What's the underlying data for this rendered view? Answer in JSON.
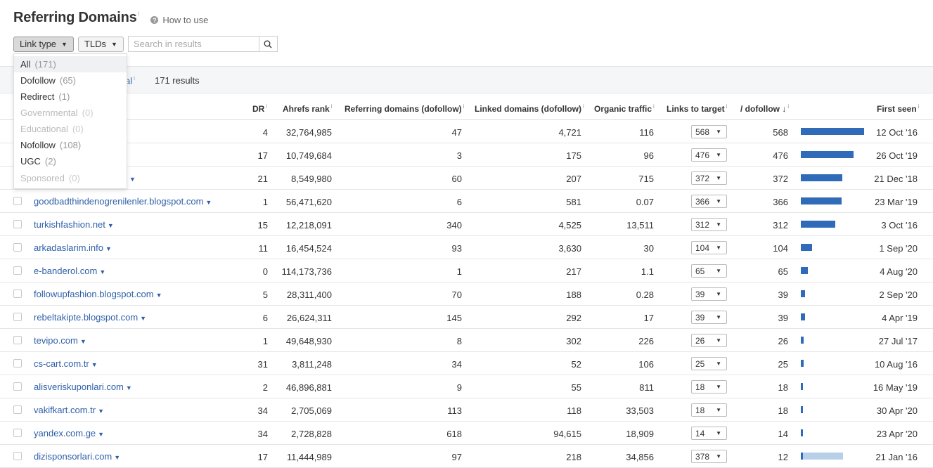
{
  "header": {
    "title": "Referring Domains",
    "info_glyph": "i",
    "how_to_label": "How to use"
  },
  "filters": {
    "link_type_label": "Link type",
    "tlds_label": "TLDs",
    "search_placeholder": "Search in results"
  },
  "link_type_menu": [
    {
      "label": "All",
      "count": "(171)",
      "enabled": true,
      "selected": true
    },
    {
      "label": "Dofollow",
      "count": "(65)",
      "enabled": true,
      "selected": false
    },
    {
      "label": "Redirect",
      "count": "(1)",
      "enabled": true,
      "selected": false
    },
    {
      "label": "Governmental",
      "count": "(0)",
      "enabled": false,
      "selected": false
    },
    {
      "label": "Educational",
      "count": "(0)",
      "enabled": false,
      "selected": false
    },
    {
      "label": "Nofollow",
      "count": "(108)",
      "enabled": true,
      "selected": false
    },
    {
      "label": "UGC",
      "count": "(2)",
      "enabled": true,
      "selected": false
    },
    {
      "label": "Sponsored",
      "count": "(0)",
      "enabled": false,
      "selected": false
    }
  ],
  "tabs": {
    "partial_tab_label": "al",
    "results": "171 results"
  },
  "table": {
    "headers": {
      "dr": "DR",
      "ahrefs_rank": "Ahrefs rank",
      "referring_domains": "Referring domains (dofollow)",
      "linked_domains": "Linked domains (dofollow)",
      "organic_traffic": "Organic traffic",
      "links_to_target": "Links to target",
      "dofollow": "/ dofollow",
      "sort_arrow": "↓",
      "first_seen": "First seen"
    },
    "max_links": 568,
    "rows": [
      {
        "domain": "",
        "dr": "4",
        "rank": "32,764,985",
        "ref": "47",
        "linked": "4,721",
        "traffic": "116",
        "links": "568",
        "dofollow": "568",
        "first_seen": "12 Oct '16",
        "dofollow_ratio": 1.0
      },
      {
        "domain": "",
        "dr": "17",
        "rank": "10,749,684",
        "ref": "3",
        "linked": "175",
        "traffic": "96",
        "links": "476",
        "dofollow": "476",
        "first_seen": "26 Oct '19",
        "dofollow_ratio": 1.0
      },
      {
        "domain": "",
        "dr": "21",
        "rank": "8,549,980",
        "ref": "60",
        "linked": "207",
        "traffic": "715",
        "links": "372",
        "dofollow": "372",
        "first_seen": "21 Dec '18",
        "dofollow_ratio": 1.0,
        "caret_only": true
      },
      {
        "domain": "goodbadthindenogrenilenler.blogspot.com",
        "dr": "1",
        "rank": "56,471,620",
        "ref": "6",
        "linked": "581",
        "traffic": "0.07",
        "links": "366",
        "dofollow": "366",
        "first_seen": "23 Mar '19",
        "dofollow_ratio": 1.0
      },
      {
        "domain": "turkishfashion.net",
        "dr": "15",
        "rank": "12,218,091",
        "ref": "340",
        "linked": "4,525",
        "traffic": "13,511",
        "links": "312",
        "dofollow": "312",
        "first_seen": "3 Oct '16",
        "dofollow_ratio": 1.0
      },
      {
        "domain": "arkadaslarim.info",
        "dr": "11",
        "rank": "16,454,524",
        "ref": "93",
        "linked": "3,630",
        "traffic": "30",
        "links": "104",
        "dofollow": "104",
        "first_seen": "1 Sep '20",
        "dofollow_ratio": 1.0
      },
      {
        "domain": "e-banderol.com",
        "dr": "0",
        "rank": "114,173,736",
        "ref": "1",
        "linked": "217",
        "traffic": "1.1",
        "links": "65",
        "dofollow": "65",
        "first_seen": "4 Aug '20",
        "dofollow_ratio": 1.0
      },
      {
        "domain": "followupfashion.blogspot.com",
        "dr": "5",
        "rank": "28,311,400",
        "ref": "70",
        "linked": "188",
        "traffic": "0.28",
        "links": "39",
        "dofollow": "39",
        "first_seen": "2 Sep '20",
        "dofollow_ratio": 1.0
      },
      {
        "domain": "rebeltakipte.blogspot.com",
        "dr": "6",
        "rank": "26,624,311",
        "ref": "145",
        "linked": "292",
        "traffic": "17",
        "links": "39",
        "dofollow": "39",
        "first_seen": "4 Apr '19",
        "dofollow_ratio": 1.0
      },
      {
        "domain": "tevipo.com",
        "dr": "1",
        "rank": "49,648,930",
        "ref": "8",
        "linked": "302",
        "traffic": "226",
        "links": "26",
        "dofollow": "26",
        "first_seen": "27 Jul '17",
        "dofollow_ratio": 1.0
      },
      {
        "domain": "cs-cart.com.tr",
        "dr": "31",
        "rank": "3,811,248",
        "ref": "34",
        "linked": "52",
        "traffic": "106",
        "links": "25",
        "dofollow": "25",
        "first_seen": "10 Aug '16",
        "dofollow_ratio": 1.0
      },
      {
        "domain": "alisveriskuponlari.com",
        "dr": "2",
        "rank": "46,896,881",
        "ref": "9",
        "linked": "55",
        "traffic": "811",
        "links": "18",
        "dofollow": "18",
        "first_seen": "16 May '19",
        "dofollow_ratio": 1.0
      },
      {
        "domain": "vakifkart.com.tr",
        "dr": "34",
        "rank": "2,705,069",
        "ref": "113",
        "linked": "118",
        "traffic": "33,503",
        "links": "18",
        "dofollow": "18",
        "first_seen": "30 Apr '20",
        "dofollow_ratio": 1.0
      },
      {
        "domain": "yandex.com.ge",
        "dr": "34",
        "rank": "2,728,828",
        "ref": "618",
        "linked": "94,615",
        "traffic": "18,909",
        "links": "14",
        "dofollow": "14",
        "first_seen": "23 Apr '20",
        "dofollow_ratio": 1.0
      },
      {
        "domain": "dizisponsorlari.com",
        "dr": "17",
        "rank": "11,444,989",
        "ref": "97",
        "linked": "218",
        "traffic": "34,856",
        "links": "378",
        "dofollow": "12",
        "first_seen": "21 Jan '16",
        "dofollow_ratio": 0.032
      }
    ]
  },
  "colors": {
    "bar_dark": "#2f6bb8",
    "bar_light": "#b8cfe8",
    "link": "#2f5fa8"
  }
}
